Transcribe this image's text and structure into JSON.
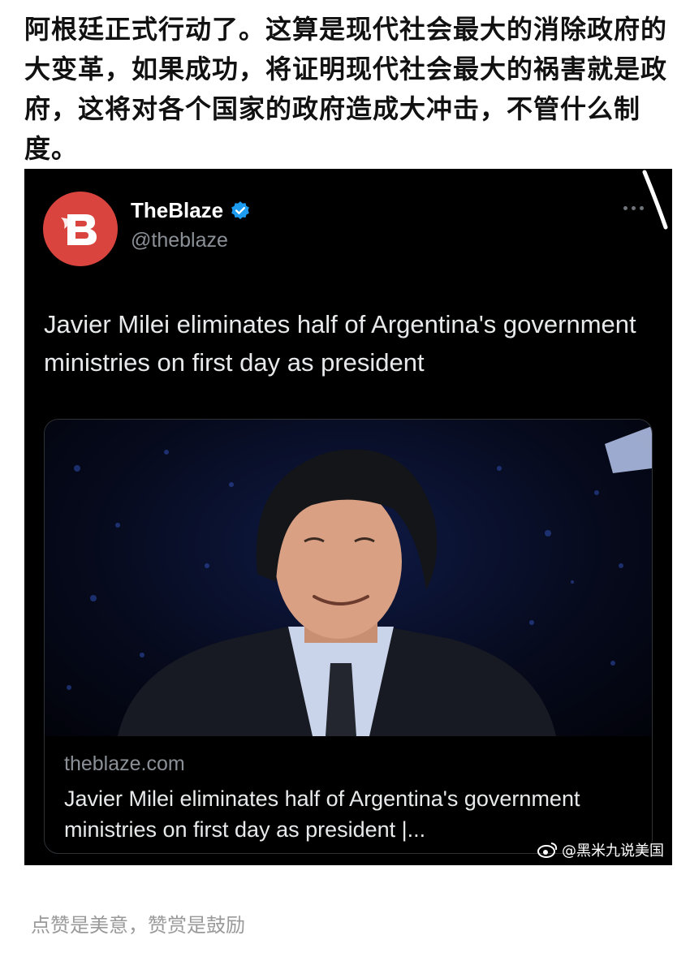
{
  "post": {
    "text": "阿根廷正式行动了。这算是现代社会最大的消除政府的大变革，如果成功，将证明现代社会最大的祸害就是政府，这将对各个国家的政府造成大冲击，不管什么制度。"
  },
  "tweet": {
    "author_name": "TheBlaze",
    "handle": "@theblaze",
    "headline": "Javier Milei eliminates half of Argentina's government ministries on first day as president",
    "avatar_letter": "B",
    "avatar_color": "#d9453e",
    "verified_color": "#1d9bf0",
    "card": {
      "domain": "theblaze.com",
      "title": "Javier Milei eliminates half of Argentina's government ministries on first day as president |..."
    }
  },
  "watermark": {
    "text": "@黑米九说美国",
    "icon": "weibo-icon"
  },
  "footer": {
    "text": "点赞是美意，赞赏是鼓励"
  }
}
